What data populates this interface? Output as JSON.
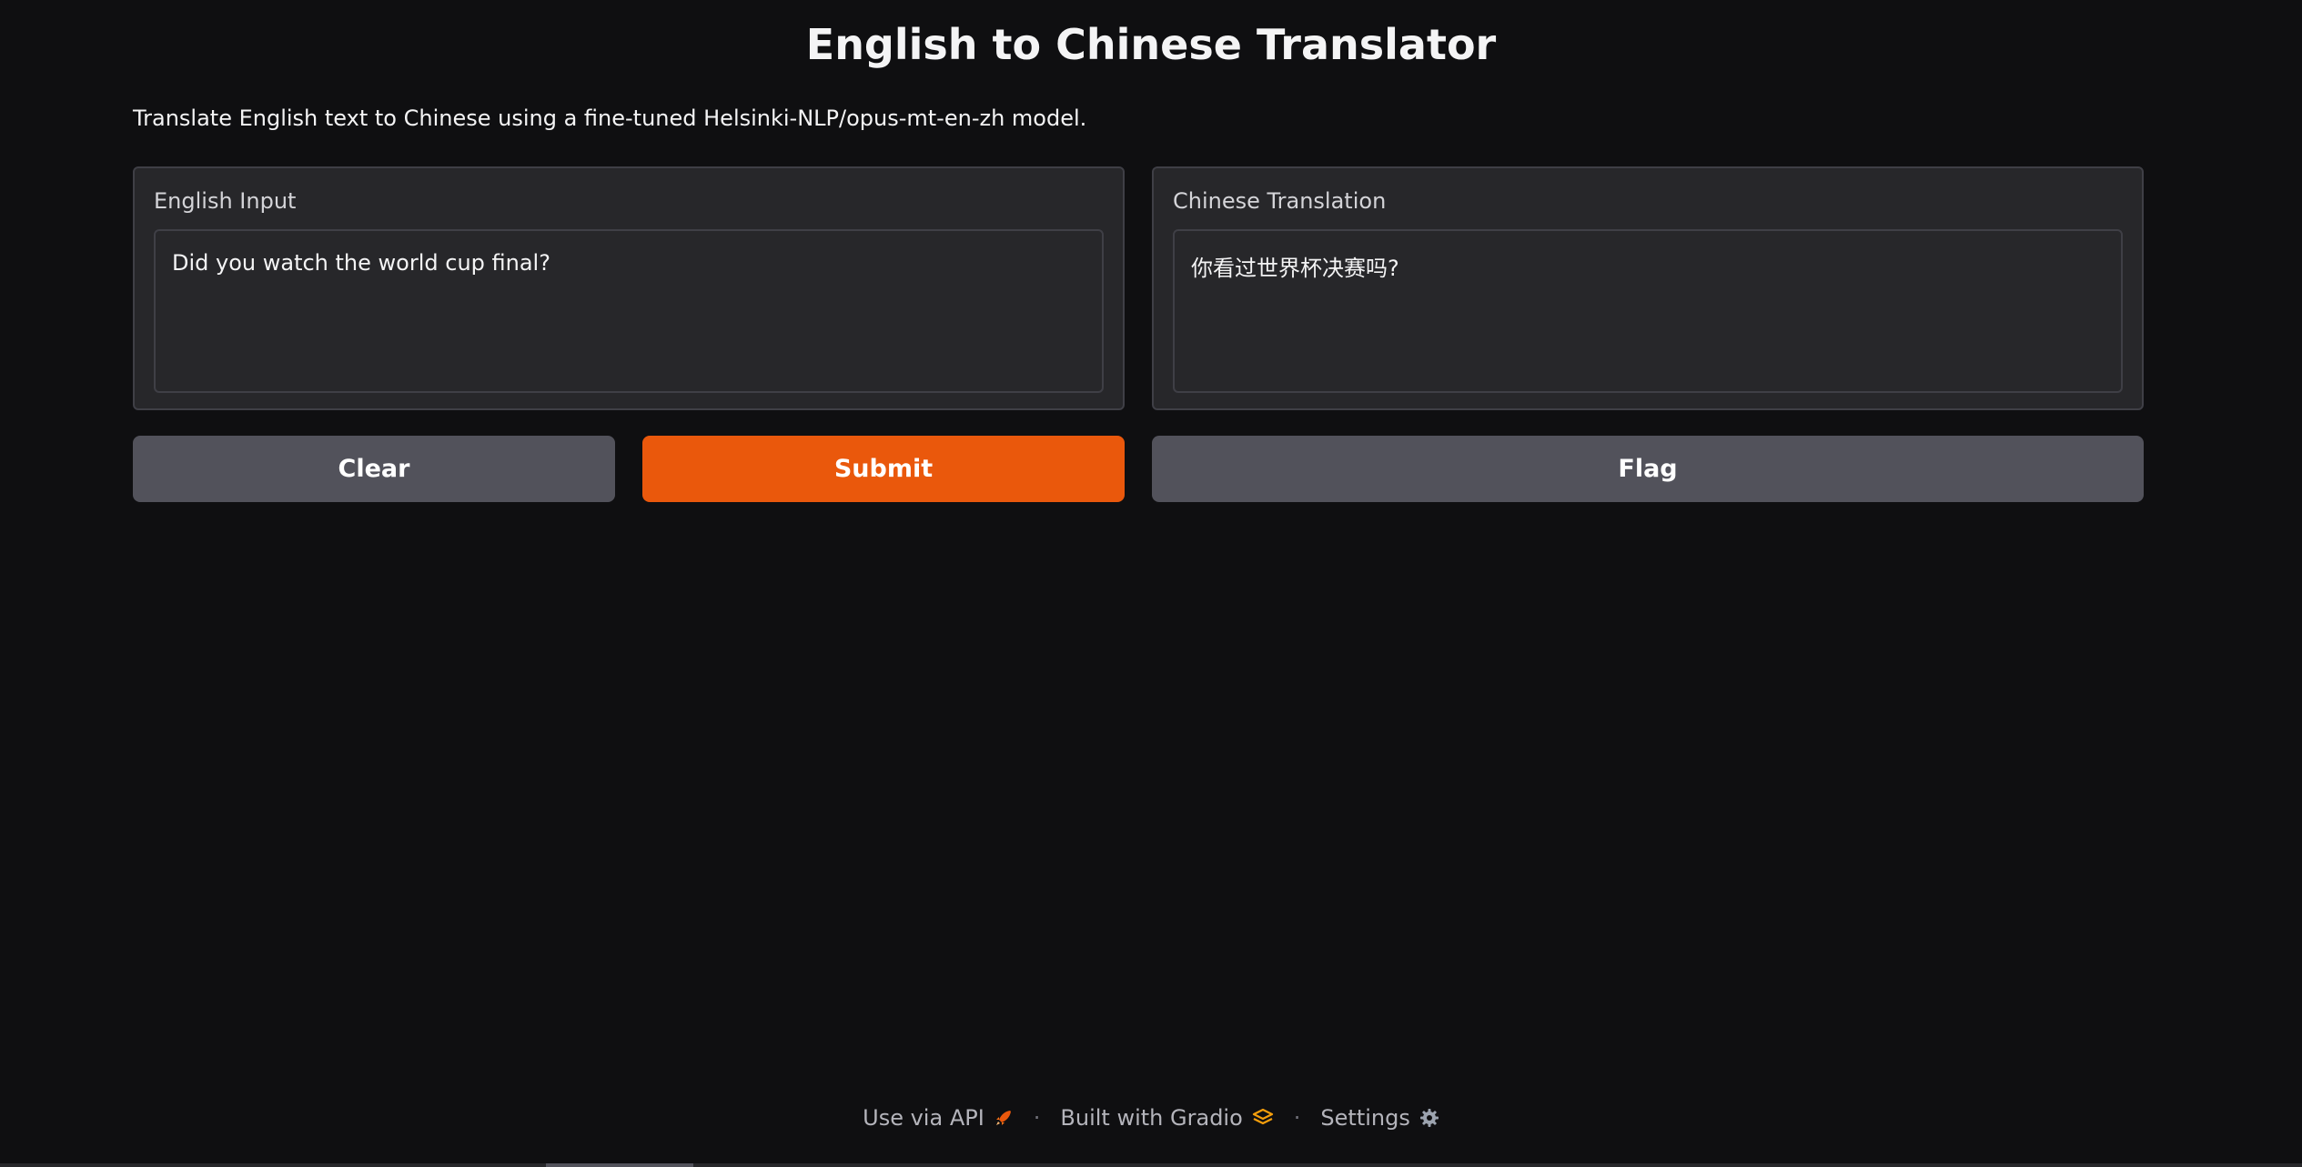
{
  "page": {
    "title": "English to Chinese Translator",
    "description": "Translate English text to Chinese using a fine-tuned Helsinki-NLP/opus-mt-en-zh model."
  },
  "input_panel": {
    "label": "English Input",
    "value": "Did you watch the world cup final?"
  },
  "output_panel": {
    "label": "Chinese Translation",
    "value": "你看过世界杯决赛吗?"
  },
  "buttons": {
    "clear_label": "Clear",
    "submit_label": "Submit",
    "flag_label": "Flag"
  },
  "footer": {
    "api_label": "Use via API",
    "api_icon": "rocket-icon",
    "separator": "·",
    "gradio_label": "Built with Gradio",
    "gradio_icon": "gradio-logo-icon",
    "settings_label": "Settings",
    "settings_icon": "gear-icon"
  },
  "colors": {
    "background": "#0f0f11",
    "panel": "#27272a",
    "accent": "#ea580c",
    "secondary_button": "#52525b"
  }
}
